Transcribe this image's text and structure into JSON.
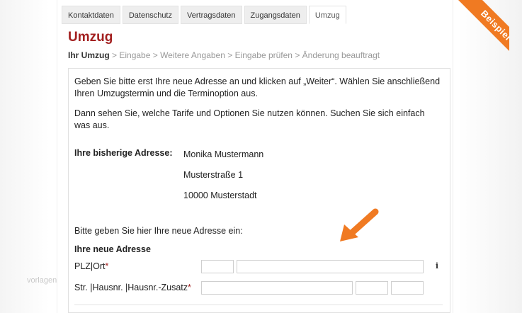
{
  "watermark": "vorlagen",
  "tabs": [
    "Kontaktdaten",
    "Datenschutz",
    "Vertragsdaten",
    "Zugangsdaten",
    "Umzug"
  ],
  "active_tab": "Umzug",
  "badge": "Beispiel",
  "page_title": "Umzug",
  "breadcrumb": {
    "current": "Ihr Umzug",
    "steps": " > Eingabe > Weitere Angaben > Eingabe prüfen > Änderung beauftragt"
  },
  "intro": {
    "p1": "Geben Sie bitte erst Ihre neue Adresse an und klicken auf  „Weiter“. Wählen Sie anschließend Ihren Umzugstermin und die Terminoption aus.",
    "p2": "Dann sehen Sie, welche Tarife und Optionen Sie nutzen können. Suchen Sie sich einfach was aus."
  },
  "old_address": {
    "label": "Ihre bisherige Adresse:",
    "name": "Monika Mustermann",
    "street": "Musterstraße 1",
    "city": "10000 Musterstadt"
  },
  "new_address": {
    "intro": "Bitte geben Sie hier Ihre neue Adresse ein:",
    "heading": "Ihre neue Adresse",
    "plz_label": "PLZ|Ort",
    "street_label": "Str. |Hausnr. |Hausnr.-Zusatz",
    "required_mark": "*",
    "info": "i"
  },
  "colors": {
    "accent": "#a32020",
    "badge": "#f07a22",
    "arrow": "#f07a22"
  }
}
